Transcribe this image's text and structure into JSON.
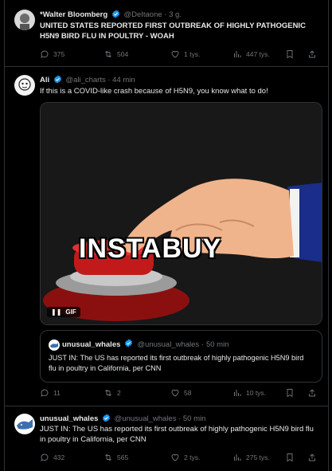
{
  "posts": [
    {
      "author": "*Walter Bloomberg",
      "handle": "@DeItaone",
      "time": "· 3 g.",
      "text": "UNITED STATES REPORTED FIRST OUTBREAK OF HIGHLY PATHOGENIC H5N9 BIRD FLU IN POULTRY - WOAH",
      "replies": "375",
      "reposts": "504",
      "likes": "1 tys.",
      "views": "447 tys."
    },
    {
      "author": "Ali",
      "handle": "@ali_charts",
      "time": "· 44 min",
      "text": "If this is a COVID-like crash because of H5N9, you know what to do!",
      "media": {
        "caption": "INSTABUY",
        "badge": "GIF"
      },
      "quote": {
        "author": "unusual_whales",
        "handle": "@unusual_whales",
        "time": "· 50 min",
        "text": "JUST IN: The US has reported its first outbreak of highly pathogenic H5N9 bird flu in poultry in California, per CNN"
      },
      "replies": "11",
      "reposts": "2",
      "likes": "58",
      "views": "10 tys."
    },
    {
      "author": "unusual_whales",
      "handle": "@unusual_whales",
      "time": "· 50 min",
      "text": "JUST IN: The US has reported its first outbreak of highly pathogenic H5N9 bird flu in poultry in California, per CNN",
      "replies": "432",
      "reposts": "565",
      "likes": "2 tys.",
      "views": "275 tys."
    }
  ],
  "colors": {
    "background": "#000000",
    "muted": "#71767b",
    "verified": "#1d9bf0",
    "border": "#2f3336"
  }
}
